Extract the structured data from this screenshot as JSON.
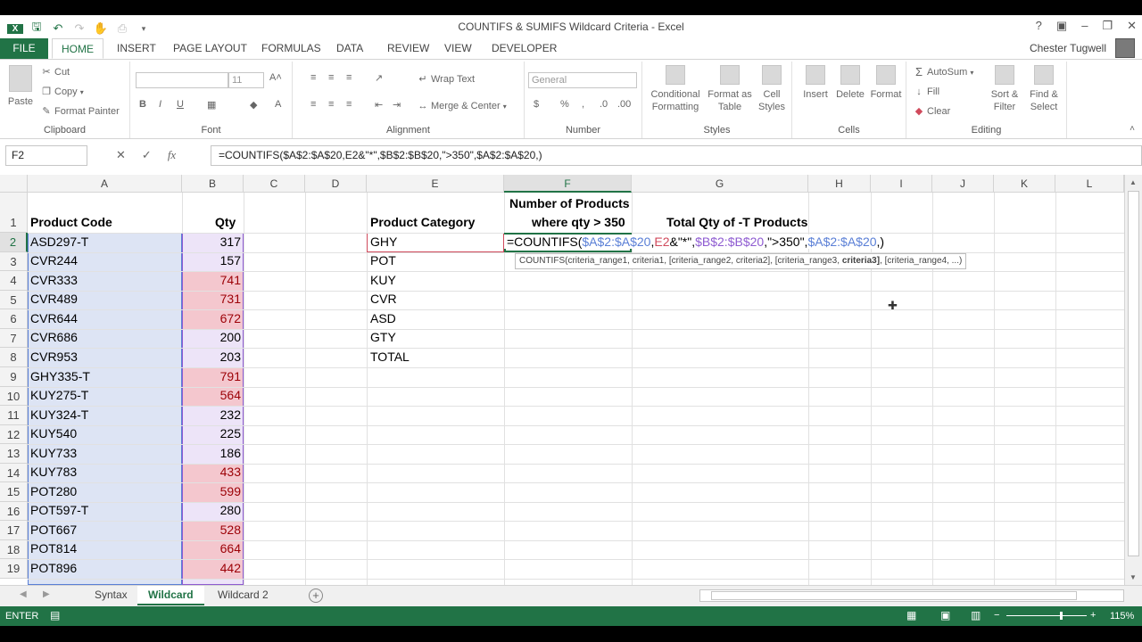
{
  "window": {
    "title": "COUNTIFS & SUMIFS Wildcard Criteria - Excel",
    "help": "?",
    "user": "Chester Tugwell"
  },
  "tabs": [
    "FILE",
    "HOME",
    "INSERT",
    "PAGE LAYOUT",
    "FORMULAS",
    "DATA",
    "REVIEW",
    "VIEW",
    "DEVELOPER"
  ],
  "ribbon": {
    "clipboard": {
      "paste": "Paste",
      "cut": "Cut",
      "copy": "Copy",
      "format_painter": "Format Painter",
      "label": "Clipboard"
    },
    "font": {
      "size": "11",
      "label": "Font"
    },
    "alignment": {
      "wrap": "Wrap Text",
      "merge": "Merge & Center",
      "label": "Alignment"
    },
    "number": {
      "format": "General",
      "label": "Number"
    },
    "styles": {
      "conditional": "Conditional",
      "formatting": "Formatting",
      "format_as": "Format as",
      "table": "Table",
      "cell": "Cell",
      "cell_styles": "Styles",
      "label": "Styles"
    },
    "cells": {
      "insert": "Insert",
      "delete": "Delete",
      "format": "Format",
      "label": "Cells"
    },
    "editing": {
      "autosum": "AutoSum",
      "fill": "Fill",
      "clear": "Clear",
      "sort": "Sort &",
      "filter": "Filter",
      "find": "Find &",
      "select": "Select",
      "label": "Editing"
    }
  },
  "formula_bar": {
    "name_box": "F2",
    "formula": "=COUNTIFS($A$2:$A$20,E2&\"*\",$B$2:$B$20,\">350\",$A$2:$A$20,)"
  },
  "columns": [
    "A",
    "B",
    "C",
    "D",
    "E",
    "F",
    "G",
    "H",
    "I",
    "J",
    "K",
    "L"
  ],
  "rows": [
    "1",
    "2",
    "3",
    "4",
    "5",
    "6",
    "7",
    "8",
    "9",
    "10",
    "11",
    "12",
    "13",
    "14",
    "15",
    "16",
    "17",
    "18",
    "19"
  ],
  "headers": {
    "product_code": "Product Code",
    "qty": "Qty",
    "product_category": "Product Category",
    "num_products_1": "Number of Products",
    "num_products_2": "where qty > 350",
    "total_qty": "Total Qty of -T Products"
  },
  "data": [
    {
      "code": "ASD297-T",
      "qty": "317"
    },
    {
      "code": "CVR244",
      "qty": "157"
    },
    {
      "code": "CVR333",
      "qty": "741"
    },
    {
      "code": "CVR489",
      "qty": "731"
    },
    {
      "code": "CVR644",
      "qty": "672"
    },
    {
      "code": "CVR686",
      "qty": "200"
    },
    {
      "code": "CVR953",
      "qty": "203"
    },
    {
      "code": "GHY335-T",
      "qty": "791"
    },
    {
      "code": "KUY275-T",
      "qty": "564"
    },
    {
      "code": "KUY324-T",
      "qty": "232"
    },
    {
      "code": "KUY540",
      "qty": "225"
    },
    {
      "code": "KUY733",
      "qty": "186"
    },
    {
      "code": "KUY783",
      "qty": "433"
    },
    {
      "code": "POT280",
      "qty": "599"
    },
    {
      "code": "POT597-T",
      "qty": "280"
    },
    {
      "code": "POT667",
      "qty": "528"
    },
    {
      "code": "POT814",
      "qty": "664"
    },
    {
      "code": "POT896",
      "qty": "442"
    }
  ],
  "categories": [
    "GHY",
    "POT",
    "KUY",
    "CVR",
    "ASD",
    "GTY",
    "TOTAL"
  ],
  "editing_cell": {
    "p1": "=COUNTIFS(",
    "p2": "$A$2:$A$20",
    "p3": ",",
    "p4": "E2",
    "p5": "&\"*\",",
    "p6": "$B$2:$B$20",
    "p7": ",\">350\",",
    "p8": "$A$2:$A$20",
    "p9": ",)"
  },
  "tooltip": {
    "a": "COUNTIFS(criteria_range1, criteria1, [criteria_range2, criteria2], [criteria_range3, ",
    "b": "criteria3]",
    "c": ", [criteria_range4, ...)"
  },
  "sheet_tabs": [
    "Syntax",
    "Wildcard",
    "Wildcard 2"
  ],
  "status": {
    "mode": "ENTER",
    "zoom": "115%"
  },
  "colors": {
    "excel_green": "#217346",
    "highlight_red": "#f4c7ce",
    "highlight_blue": "#dde4f4",
    "ref_blue": "#5a7fd6",
    "ref_red": "#d04a5c",
    "ref_purple": "#8e5bd1"
  }
}
